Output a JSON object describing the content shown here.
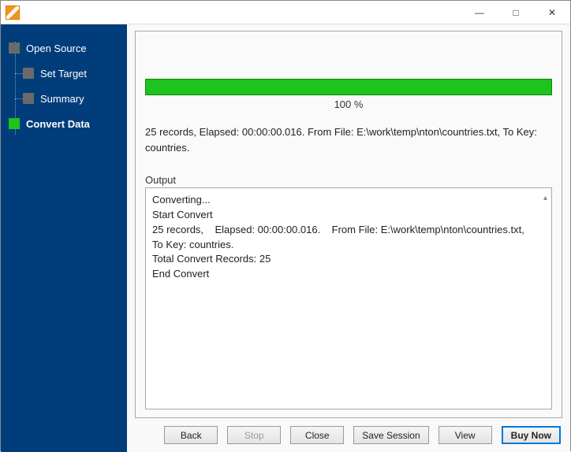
{
  "sidebar": {
    "items": [
      {
        "label": "Open Source"
      },
      {
        "label": "Set Target"
      },
      {
        "label": "Summary"
      },
      {
        "label": "Convert Data"
      }
    ]
  },
  "progress": {
    "percent_text": "100 %"
  },
  "status": {
    "line": "25 records,    Elapsed: 00:00:00.016.    From File: E:\\work\\temp\\nton\\countries.txt,    To Key: countries."
  },
  "output": {
    "label": "Output",
    "text": "Converting...\nStart Convert\n25 records,    Elapsed: 00:00:00.016.    From File: E:\\work\\temp\\nton\\countries.txt,    To Key: countries.\nTotal Convert Records: 25\nEnd Convert"
  },
  "buttons": {
    "back": "Back",
    "stop": "Stop",
    "close": "Close",
    "save_session": "Save Session",
    "view": "View",
    "buy_now": "Buy Now"
  }
}
